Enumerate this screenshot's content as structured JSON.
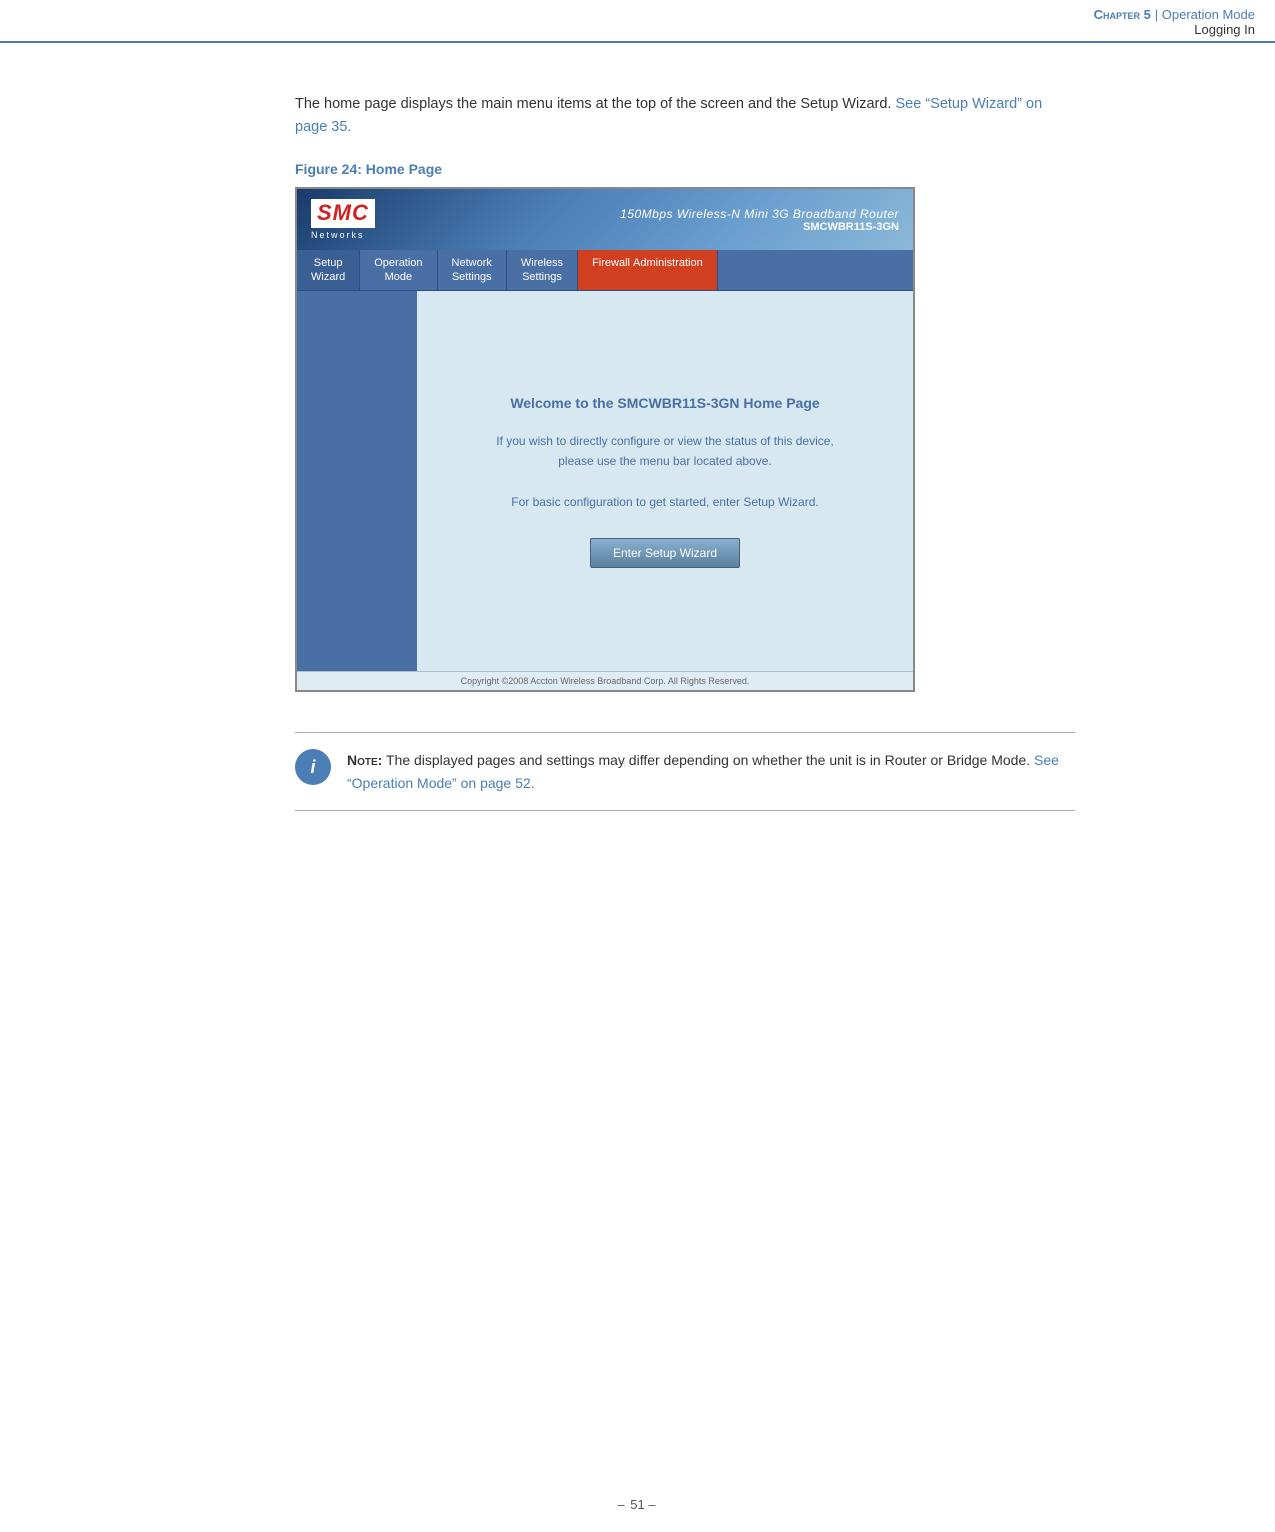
{
  "header": {
    "chapter_label": "Chapter 5",
    "separator": " | ",
    "section_link": "Operation Mode",
    "sub_section": "Logging In"
  },
  "intro": {
    "text": "The home page displays the main menu items at the top of the screen and the Setup Wizard.",
    "link_text": "See “Setup Wizard” on page 35.",
    "link_href": "#"
  },
  "figure": {
    "label": "Figure 24:",
    "title": "Home Page"
  },
  "router_ui": {
    "logo_text": "SMC",
    "logo_sub": "Networks",
    "product_title": "150Mbps Wireless-N Mini 3G Broadband Router",
    "product_model": "SMCWBR11S-3GN",
    "nav_items": [
      {
        "line1": "Setup",
        "line2": "Wizard"
      },
      {
        "line1": "Operation",
        "line2": "Mode"
      },
      {
        "line1": "Network",
        "line2": "Settings"
      },
      {
        "line1": "Wireless",
        "line2": "Settings"
      },
      {
        "line1": "Firewall",
        "line2": "Administration"
      }
    ],
    "welcome_title": "Welcome to the SMCWBR11S-3GN Home Page",
    "welcome_line1": "If you wish to directly configure or view the status of this device,",
    "welcome_line2": "please use the menu bar located above.",
    "welcome_line3": "For basic configuration to get started, enter Setup Wizard.",
    "setup_button": "Enter Setup Wizard",
    "footer_text": "Copyright ©2008 Accton Wireless Broadband Corp. All Rights Reserved."
  },
  "note": {
    "icon": "i",
    "label": "Note:",
    "text": "The displayed pages and settings may differ depending on whether the unit is in Router or Bridge Mode.",
    "link_text": "See “Operation Mode” on page 52.",
    "link_href": "#"
  },
  "page_number": {
    "prefix": "–",
    "number": "51",
    "suffix": "–"
  }
}
